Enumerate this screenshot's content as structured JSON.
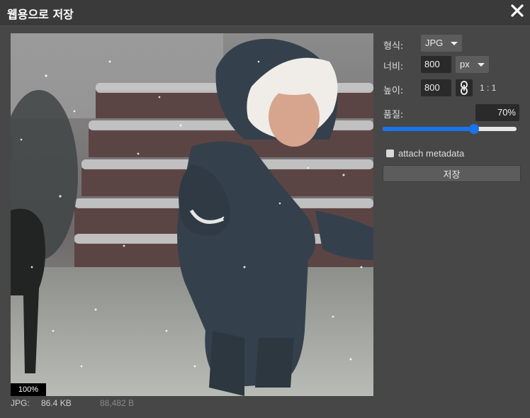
{
  "dialog": {
    "title": "웹용으로 저장",
    "close_icon": "close-icon"
  },
  "preview": {
    "zoom": "100%",
    "format_label": "JPG:",
    "file_size": "86.4 KB",
    "file_bytes": "88,482 B"
  },
  "settings": {
    "format_label": "형식:",
    "format_value": "JPG",
    "width_label": "너비:",
    "width_value": "800",
    "unit_value": "px",
    "height_label": "높이:",
    "height_value": "800",
    "link_icon": "chain-link-icon",
    "ratio": "1 : 1",
    "quality_label": "품질:",
    "quality_value": "70%",
    "quality_fraction": 0.68,
    "metadata_label": "attach metadata",
    "metadata_checked": false,
    "save_label": "저장"
  },
  "colors": {
    "background": "#474747",
    "titlebar": "#3a3a3a",
    "accent": "#1a73e8"
  }
}
